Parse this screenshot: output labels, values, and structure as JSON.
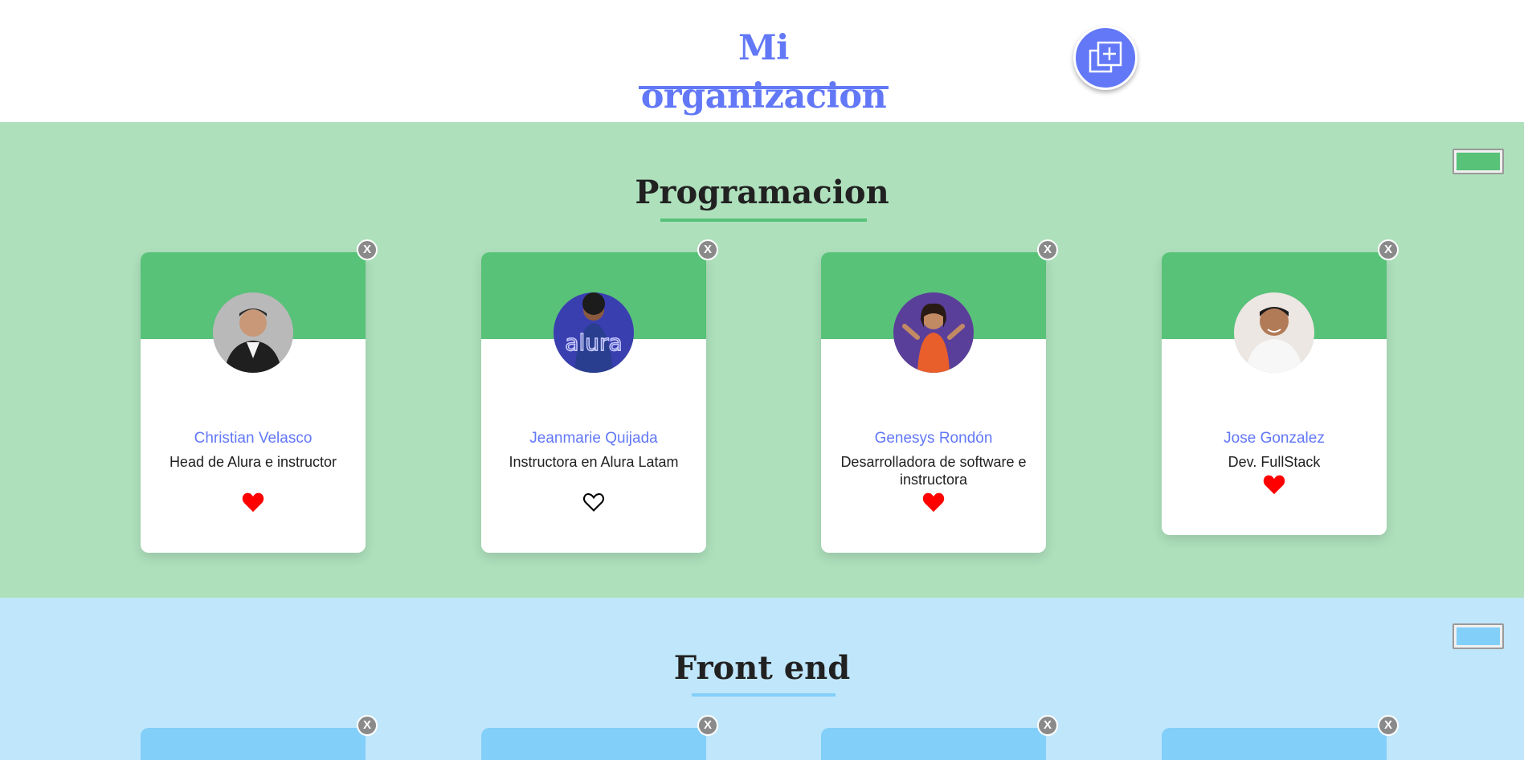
{
  "header": {
    "title": "Mi organizacion",
    "accent_color": "#6278F7",
    "add_button_icon": "add-copy-icon"
  },
  "teams": [
    {
      "title": "Programacion",
      "primary_color": "#57C278",
      "background_color": "#AEE0BC",
      "members": [
        {
          "name": "Christian Velasco",
          "role": "Head de Alura e instructor",
          "favorite": true,
          "avatar_icon": "person-photo"
        },
        {
          "name": "Jeanmarie Quijada",
          "role": "Instructora en Alura Latam",
          "favorite": false,
          "avatar_icon": "person-photo"
        },
        {
          "name": "Genesys Rondón",
          "role": "Desarrolladora de software e instructora",
          "favorite": true,
          "avatar_icon": "person-photo"
        },
        {
          "name": "Jose Gonzalez",
          "role": "Dev. FullStack",
          "favorite": true,
          "avatar_icon": "person-photo"
        }
      ]
    },
    {
      "title": "Front end",
      "primary_color": "#82CFFA",
      "background_color": "#C0E6FB"
    }
  ],
  "card_close_label": "X"
}
